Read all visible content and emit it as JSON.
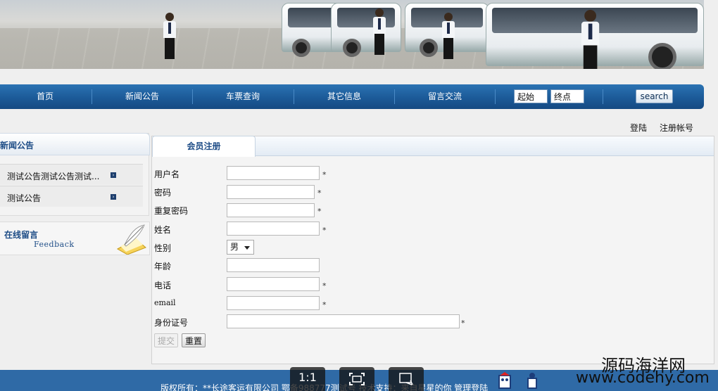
{
  "nav": {
    "items": [
      "首页",
      "新闻公告",
      "车票查询",
      "其它信息",
      "留言交流"
    ],
    "search": {
      "from_value": "起始",
      "to_value": "终点",
      "button": "search"
    }
  },
  "auth": {
    "login": "登陆",
    "register": "注册帐号"
  },
  "sidebar": {
    "news_title": "新闻公告",
    "news": [
      "测试公告测试公告测试...",
      "测试公告"
    ],
    "message_title": "在线留言",
    "message_sub": "Feedback"
  },
  "main": {
    "tab": "会员注册",
    "fields": {
      "username": "用户名",
      "password": "密码",
      "confirm_password": "重复密码",
      "name": "姓名",
      "gender": "性别",
      "age": "年龄",
      "phone": "电话",
      "email": "email",
      "id_number": "身份证号"
    },
    "required_mark": "*",
    "gender_value": "男",
    "submit": "提交",
    "reset": "重置"
  },
  "footer": {
    "text": "版权所有：**长途客运有限公司   鄂备988777测试号  技术支持：来自星星的你   管理登陆"
  },
  "overlay": {
    "ratio": "1:1"
  },
  "watermark": {
    "cn": "源码海洋网",
    "en": "www.codehy.com"
  },
  "colors": {
    "nav_blue": "#1c5a98",
    "title_blue": "#1d4c86",
    "footer_blue": "#2f6aa6"
  }
}
